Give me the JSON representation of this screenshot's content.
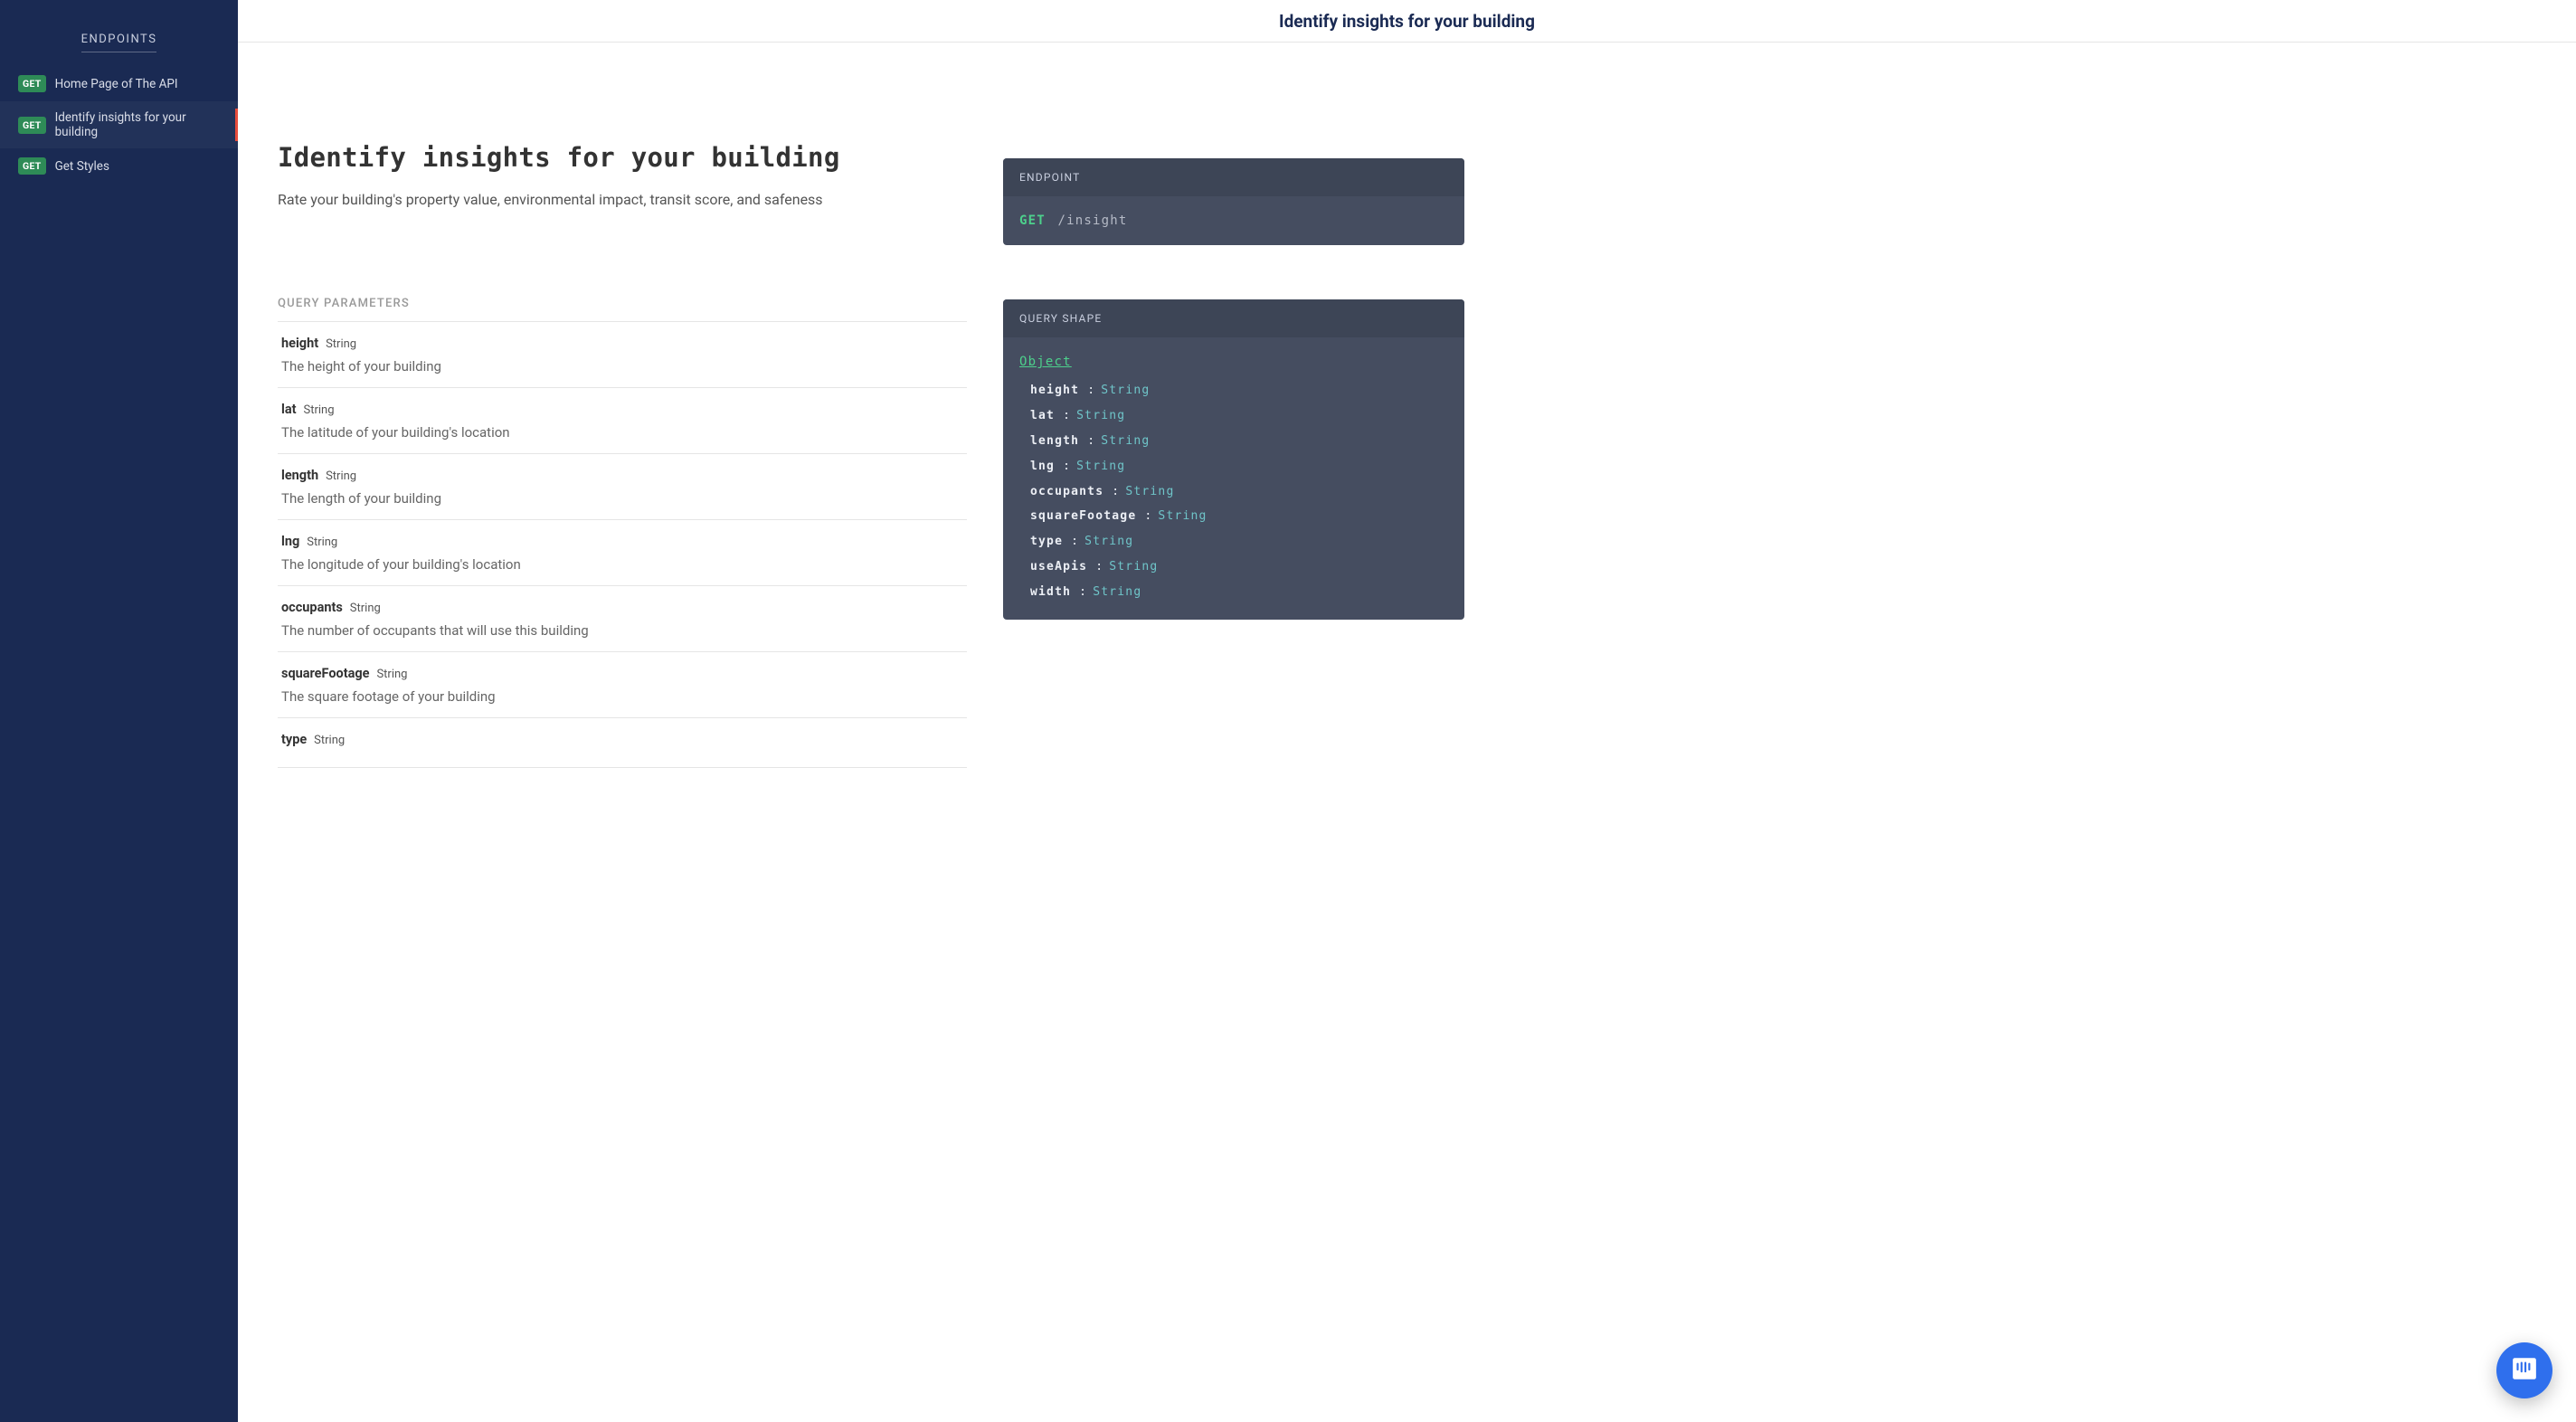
{
  "sidebar": {
    "header": "ENDPOINTS",
    "items": [
      {
        "method": "GET",
        "label": "Home Page of The API",
        "active": false
      },
      {
        "method": "GET",
        "label": "Identify insights for your building",
        "active": true
      },
      {
        "method": "GET",
        "label": "Get Styles",
        "active": false
      }
    ]
  },
  "topbar": {
    "title": "Identify insights for your building"
  },
  "page": {
    "title": "Identify insights for your building",
    "description": "Rate your building's property value, environmental impact, transit score, and safeness",
    "params_label": "QUERY PARAMETERS",
    "params": [
      {
        "name": "height",
        "type": "String",
        "desc": "The height of your building"
      },
      {
        "name": "lat",
        "type": "String",
        "desc": "The latitude of your building's location"
      },
      {
        "name": "length",
        "type": "String",
        "desc": "The length of your building"
      },
      {
        "name": "lng",
        "type": "String",
        "desc": "The longitude of your building's location"
      },
      {
        "name": "occupants",
        "type": "String",
        "desc": "The number of occupants that will use this building"
      },
      {
        "name": "squareFootage",
        "type": "String",
        "desc": "The square footage of your building"
      },
      {
        "name": "type",
        "type": "String",
        "desc": ""
      }
    ]
  },
  "endpoint_panel": {
    "label": "ENDPOINT",
    "method": "GET",
    "path": "/insight"
  },
  "shape_panel": {
    "label": "QUERY SHAPE",
    "root": "Object",
    "fields": [
      {
        "key": "height",
        "type": "String"
      },
      {
        "key": "lat",
        "type": "String"
      },
      {
        "key": "length",
        "type": "String"
      },
      {
        "key": "lng",
        "type": "String"
      },
      {
        "key": "occupants",
        "type": "String"
      },
      {
        "key": "squareFootage",
        "type": "String"
      },
      {
        "key": "type",
        "type": "String"
      },
      {
        "key": "useApis",
        "type": "String"
      },
      {
        "key": "width",
        "type": "String"
      }
    ]
  }
}
